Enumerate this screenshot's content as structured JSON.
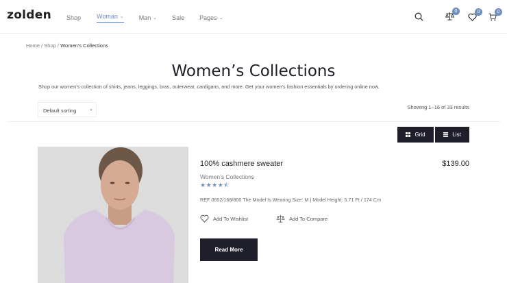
{
  "header": {
    "logo": "zolden",
    "nav": [
      {
        "label": "Shop"
      },
      {
        "label": "Woman"
      },
      {
        "label": "Man"
      },
      {
        "label": "Sale"
      },
      {
        "label": "Pages"
      }
    ],
    "icons": {
      "search": "search-icon",
      "compare": "scale-icon",
      "wishlist": "heart-icon",
      "cart": "cart-icon"
    },
    "badges": {
      "compare": "0",
      "wishlist": "0",
      "cart": "0"
    },
    "accent_color": "#6e8fc0"
  },
  "breadcrumb": {
    "home": "Home",
    "sep1": " / ",
    "shop": "Shop",
    "sep2": " / ",
    "current": "Women’s Collections"
  },
  "page": {
    "title": "Women’s Collections",
    "description": "Shop our women’s collection of shirts, jeans, leggings, bras, outerwear, cardigans, and more. Get your women’s fashion essentials by ordering online now."
  },
  "toolbar": {
    "sorting_value": "Default sorting",
    "results_text": "Showing 1–16 of 33 results",
    "grid_label": "Grid",
    "list_label": "List"
  },
  "product": {
    "name": "100% cashmere sweater",
    "price": "$139.00",
    "category": "Women’s Collections",
    "rating": 4.5,
    "rating_stars": "★★★★⯪",
    "ref": "REF 0652/168/800 The Model Is Wearing Size: M | Model Height: 5.71 Ft / 174 Cm",
    "wishlist_label": "Add To Wishlist",
    "compare_label": "Add To Compare",
    "read_more_label": "Read More"
  },
  "colors": {
    "dark_button": "#1f1f2b",
    "sweater": "#d8c8e0"
  }
}
